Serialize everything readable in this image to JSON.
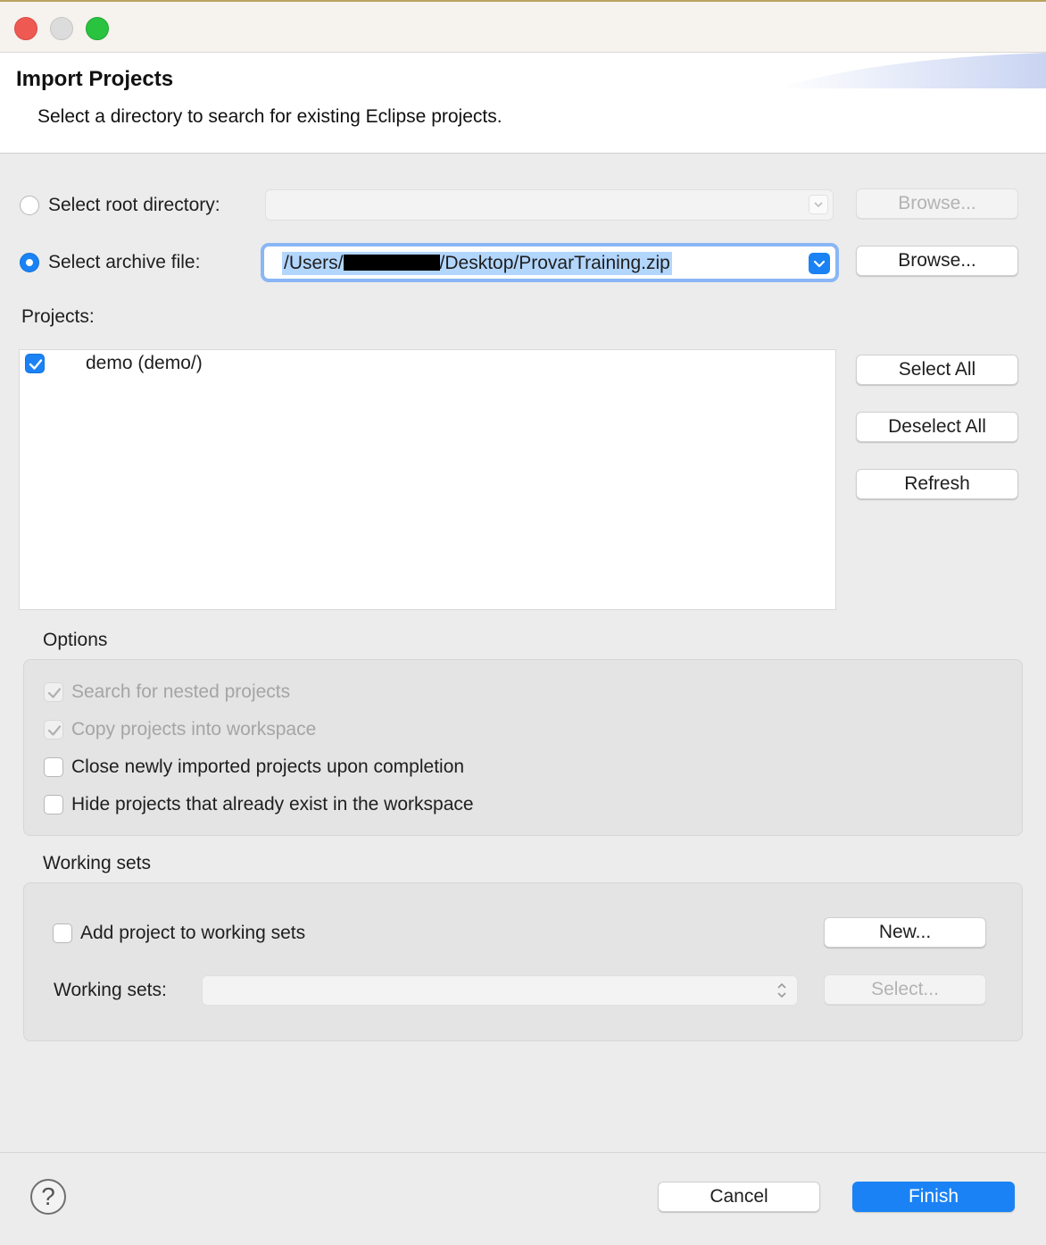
{
  "header": {
    "title": "Import Projects",
    "description": "Select a directory to search for existing Eclipse projects."
  },
  "source": {
    "root_dir_label": "Select root directory:",
    "root_dir_value": "",
    "archive_label": "Select archive file:",
    "archive_path_prefix": "/Users/",
    "archive_path_suffix": "/Desktop/ProvarTraining.zip",
    "browse_label": "Browse...",
    "selected": "archive"
  },
  "projects": {
    "label": "Projects:",
    "items": [
      {
        "label": "demo (demo/)",
        "checked": true
      }
    ],
    "select_all": "Select All",
    "deselect_all": "Deselect All",
    "refresh": "Refresh"
  },
  "options": {
    "title": "Options",
    "items": [
      {
        "label": "Search for nested projects",
        "checked": true,
        "enabled": false
      },
      {
        "label": "Copy projects into workspace",
        "checked": true,
        "enabled": false
      },
      {
        "label": "Close newly imported projects upon completion",
        "checked": false,
        "enabled": true
      },
      {
        "label": "Hide projects that already exist in the workspace",
        "checked": false,
        "enabled": true
      }
    ]
  },
  "working_sets": {
    "title": "Working sets",
    "add_label": "Add project to working sets",
    "new_button": "New...",
    "sets_label": "Working sets:",
    "sets_value": "",
    "select_button": "Select..."
  },
  "footer": {
    "help": "?",
    "cancel": "Cancel",
    "finish": "Finish"
  },
  "colors": {
    "accent": "#1a82f5",
    "title_bar": "#f6f2ee",
    "dialog_bg": "#ececec"
  }
}
